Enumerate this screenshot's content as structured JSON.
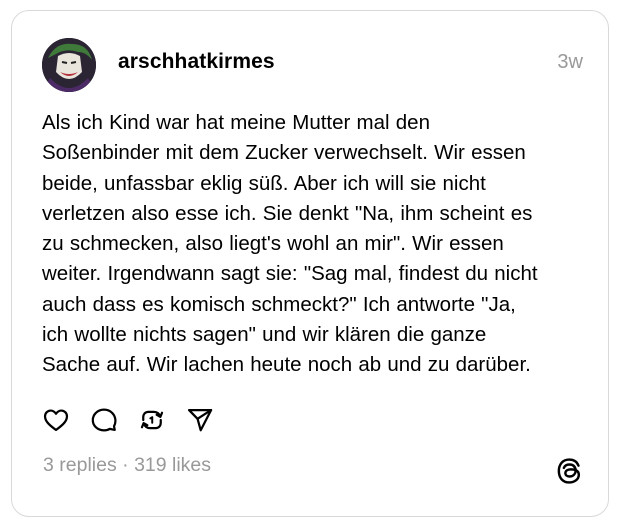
{
  "post": {
    "username": "arschhatkirmes",
    "timestamp": "3w",
    "text": "Als ich Kind war hat meine Mutter mal den\nSoßenbinder mit dem Zucker verwechselt. Wir essen\nbeide, unfassbar eklig süß. Aber ich will sie nicht\nverletzen also esse ich. Sie denkt \"Na, ihm scheint es\nzu schmecken, also liegt's wohl an mir\". Wir essen\nweiter. Irgendwann sagt sie: \"Sag mal, findest du nicht\nauch dass es komisch schmeckt?\" Ich antworte \"Ja,\nich wollte nichts sagen\" und wir klären die ganze\nSache auf. Wir lachen heute noch ab und zu darüber.",
    "replies": "3 replies",
    "separator": " · ",
    "likes": "319 likes"
  },
  "icons": {
    "like": "heart-icon",
    "reply": "comment-icon",
    "repost": "repost-icon",
    "share": "send-icon",
    "brand": "threads-logo-icon"
  },
  "colors": {
    "text": "#000000",
    "muted": "#999999",
    "border": "#d9d9d9"
  }
}
